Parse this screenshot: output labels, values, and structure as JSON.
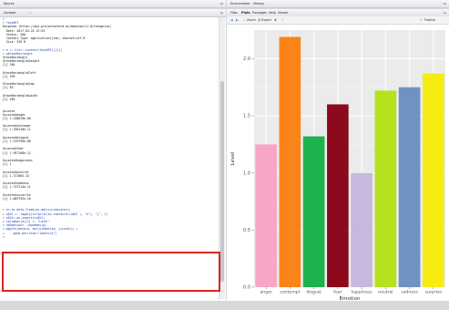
{
  "source_pane": {
    "title": "Source"
  },
  "console_pane": {
    "tab_label": "Console",
    "path": "~/",
    "lines": [
      {
        "t": "> ",
        "k": "cmd"
      },
      {
        "t": "> faceAPI",
        "k": "cmd"
      },
      {
        "t": "Response [https://api.projectoxford.ai/emotion/v1.0/recognize]",
        "k": "out"
      },
      {
        "t": "  Date: 2017-03-24 13:53",
        "k": "out"
      },
      {
        "t": "  Status: 200",
        "k": "out"
      },
      {
        "t": "  Content-Type: application/json; charset=utf-8",
        "k": "out"
      },
      {
        "t": "  Size: 259 B",
        "k": "out"
      },
      {
        "t": "",
        "k": "out"
      },
      {
        "t": "> o <- httr::content(faceAPI)[[1]]",
        "k": "cmd"
      },
      {
        "t": "> o$faceRectangle",
        "k": "cmd"
      },
      {
        "t": "$faceRectangle",
        "k": "out"
      },
      {
        "t": "$faceRectangle$height",
        "k": "out"
      },
      {
        "t": "[1] 284",
        "k": "out"
      },
      {
        "t": "",
        "k": "out"
      },
      {
        "t": "$faceRectangle$left",
        "k": "out"
      },
      {
        "t": "[1] 399",
        "k": "out"
      },
      {
        "t": "",
        "k": "out"
      },
      {
        "t": "$faceRectangle$top",
        "k": "out"
      },
      {
        "t": "[1] 83",
        "k": "out"
      },
      {
        "t": "",
        "k": "out"
      },
      {
        "t": "$faceRectangle$width",
        "k": "out"
      },
      {
        "t": "[1] 284",
        "k": "out"
      },
      {
        "t": "",
        "k": "out"
      },
      {
        "t": "",
        "k": "out"
      },
      {
        "t": "$scores",
        "k": "out"
      },
      {
        "t": "$scores$anger",
        "k": "out"
      },
      {
        "t": "[1] 1.248878e-08",
        "k": "out"
      },
      {
        "t": "",
        "k": "out"
      },
      {
        "t": "$scores$contempt",
        "k": "out"
      },
      {
        "t": "[1] 1.190118e-11",
        "k": "out"
      },
      {
        "t": "",
        "k": "out"
      },
      {
        "t": "$scores$disgust",
        "k": "out"
      },
      {
        "t": "[1] 1.319799e-08",
        "k": "out"
      },
      {
        "t": "",
        "k": "out"
      },
      {
        "t": "$scores$fear",
        "k": "out"
      },
      {
        "t": "[1] 1.997168e-12",
        "k": "out"
      },
      {
        "t": "",
        "k": "out"
      },
      {
        "t": "$scores$happiness",
        "k": "out"
      },
      {
        "t": "[1] 1",
        "k": "out"
      },
      {
        "t": "",
        "k": "out"
      },
      {
        "t": "$scores$neutral",
        "k": "out"
      },
      {
        "t": "[1] 1.717864-13",
        "k": "out"
      },
      {
        "t": "",
        "k": "out"
      },
      {
        "t": "$scores$sadness",
        "k": "out"
      },
      {
        "t": "[1] 1.747214e-11",
        "k": "out"
      },
      {
        "t": "",
        "k": "out"
      },
      {
        "t": "$scores$surprise",
        "k": "out"
      },
      {
        "t": "[1] 1.869792e-10",
        "k": "out"
      },
      {
        "t": "",
        "k": "out"
      },
      {
        "t": "",
        "k": "out"
      },
      {
        "t": "> o<-as.data.frame(as.matrix(o$scores))",
        "k": "cmd"
      },
      {
        "t": "> o$V1 <- lapply(strsplit(as.character(o$V1 ), \"e\"), \"[\", 1)",
        "k": "cmd"
      },
      {
        "t": "> o$V1<-as.numeric(o$V1)",
        "k": "cmd"
      },
      {
        "t": "> colnames(o)[1] <- \"Level\"",
        "k": "cmd"
      },
      {
        "t": "> o$Emotion<- rownames(o)",
        "k": "cmd"
      },
      {
        "t": "> ggplot(data=o, aes(x=Emotion, y=Level)) +",
        "k": "cmd"
      },
      {
        "t": "+     geom_bar(stat=\"identity\")",
        "k": "cmd"
      },
      {
        "t": ">",
        "k": "cmd"
      }
    ]
  },
  "env_pane": {
    "tabs": [
      "Environment",
      "History"
    ]
  },
  "files_pane": {
    "tabs": [
      "Files",
      "Plots",
      "Packages",
      "Help",
      "Viewer"
    ],
    "toolbar": {
      "zoom": "Zoom",
      "export": "Export",
      "publish": "Publish"
    }
  },
  "chart_data": {
    "type": "bar",
    "categories": [
      "anger",
      "contempt",
      "disgust",
      "fear",
      "happiness",
      "neutral",
      "sadness",
      "surprise"
    ],
    "values": [
      1.25,
      2.19,
      1.32,
      1.6,
      1.0,
      1.72,
      1.75,
      1.87
    ],
    "colors": [
      "#f8a6c6",
      "#fa8419",
      "#1fb14d",
      "#8b0a1d",
      "#c7b9de",
      "#b4e21f",
      "#7092c2",
      "#f6ec12"
    ],
    "xlabel": "Emotion",
    "ylabel": "Level",
    "yticks": [
      0.0,
      0.5,
      1.0,
      1.5,
      2.0
    ],
    "ytick_labels": [
      "0.0",
      "0.5",
      "1.0",
      "1.5",
      "2.0"
    ],
    "ylim": [
      0,
      2.25
    ],
    "background": "#ebebeb",
    "grid": true
  }
}
